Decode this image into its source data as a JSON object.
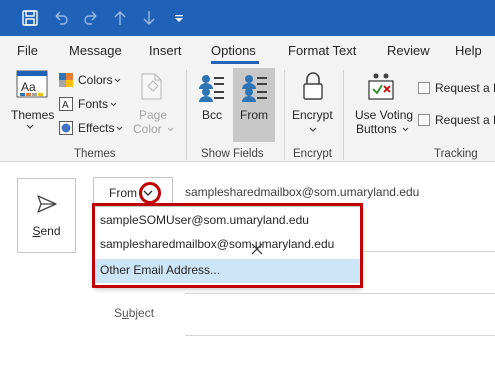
{
  "tabs": [
    {
      "label": "File"
    },
    {
      "label": "Message"
    },
    {
      "label": "Insert"
    },
    {
      "label": "Options"
    },
    {
      "label": "Format Text"
    },
    {
      "label": "Review"
    },
    {
      "label": "Help"
    }
  ],
  "active_tab": "Options",
  "ribbon": {
    "themes": {
      "themes_label": "Themes",
      "colors_label": "Colors",
      "fonts_label": "Fonts",
      "effects_label": "Effects",
      "page_color_line1": "Page",
      "page_color_line2": "Color",
      "group_label": "Themes"
    },
    "show_fields": {
      "bcc_label": "Bcc",
      "from_label": "From",
      "group_label": "Show Fields"
    },
    "encrypt": {
      "encrypt_label": "Encrypt",
      "group_label": "Encrypt"
    },
    "tracking": {
      "voting_line1": "Use Voting",
      "voting_line2": "Buttons",
      "request_delivery": "Request a D",
      "request_read": "Request a R",
      "group_label": "Tracking"
    }
  },
  "compose": {
    "send_label_underlined": "S",
    "send_label_rest": "end",
    "from_button_label": "From",
    "from_value": "samplesharedmailbox@som.umaryland.edu",
    "subject_label_underlined": "u",
    "subject_label_prefix": "S",
    "subject_label_rest": "bject"
  },
  "dropdown": {
    "items": [
      {
        "label": "sampleSOMUser@som.umaryland.edu"
      },
      {
        "label": "samplesharedmailbox@som.umaryland.edu"
      },
      {
        "label": "Other Email Address..."
      }
    ]
  },
  "colors": {
    "title_bar": "#1f62b8",
    "highlight_red": "#c00000",
    "hover_blue": "#cde6f7"
  }
}
